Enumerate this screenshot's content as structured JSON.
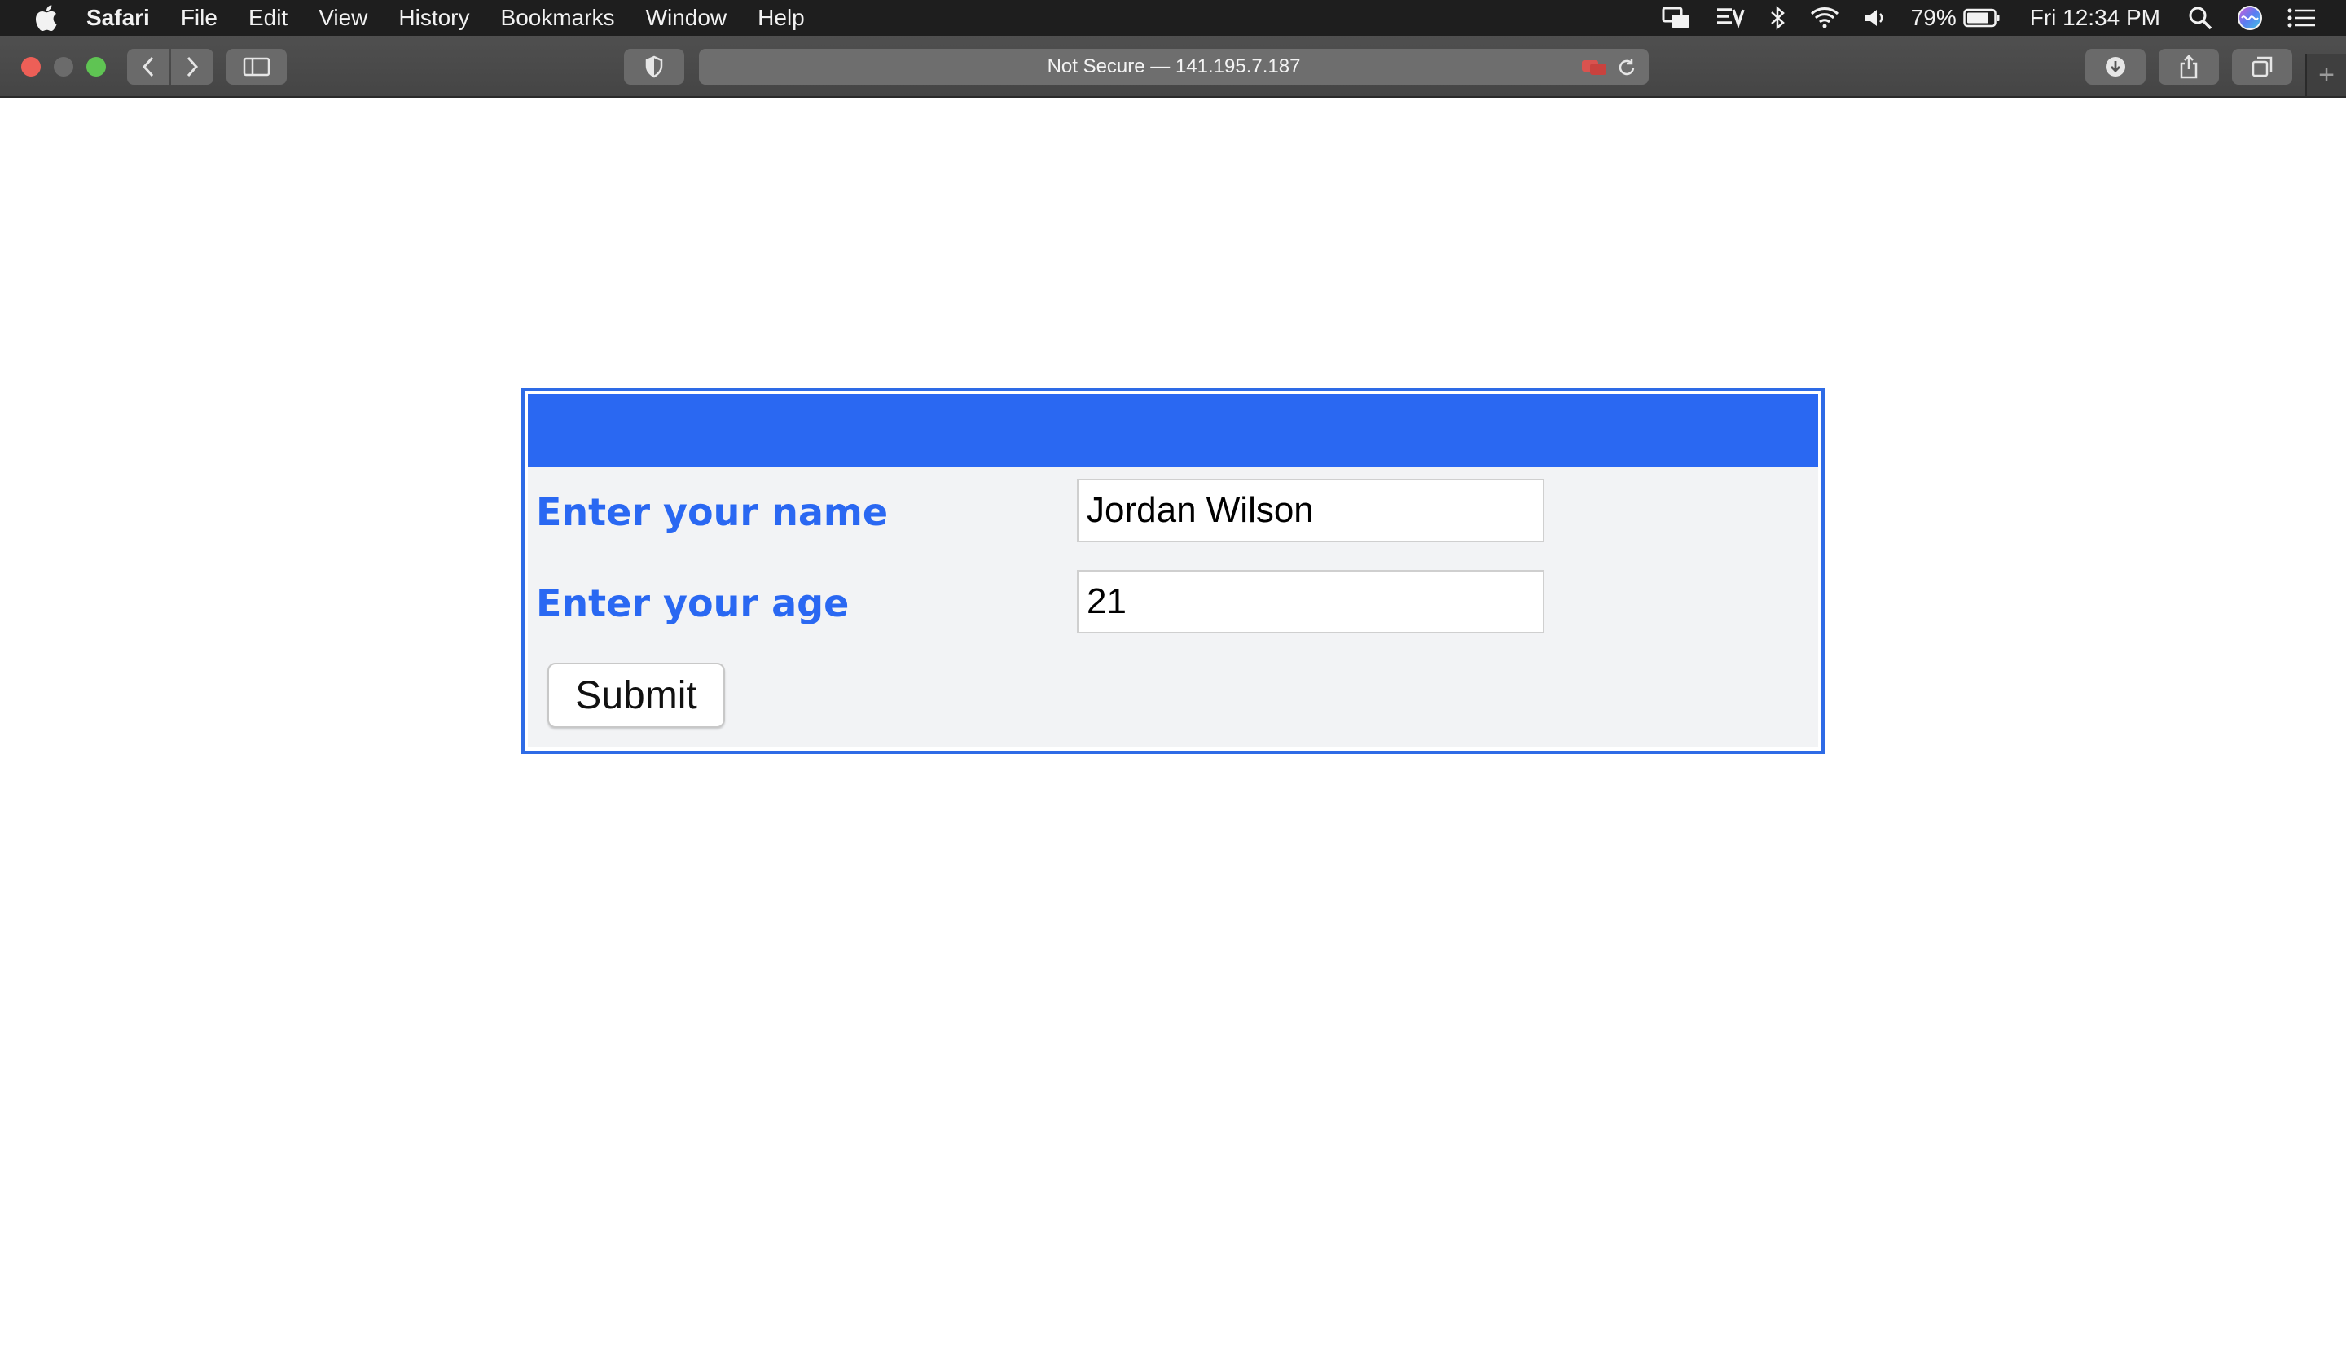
{
  "menubar": {
    "app_name": "Safari",
    "items": [
      "File",
      "Edit",
      "View",
      "History",
      "Bookmarks",
      "Window",
      "Help"
    ],
    "battery": "79%",
    "clock": "Fri 12:34 PM"
  },
  "toolbar": {
    "address": "Not Secure — 141.195.7.187"
  },
  "form": {
    "name_label": "Enter your name",
    "name_value": "Jordan Wilson",
    "age_label": "Enter your age",
    "age_value": "21",
    "submit_label": "Submit",
    "accent_color": "#2a68f2"
  }
}
